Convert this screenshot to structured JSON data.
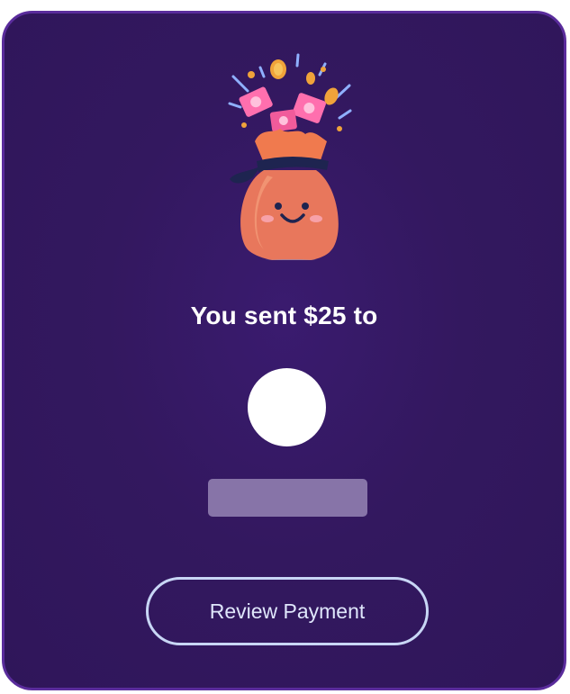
{
  "confirmation": {
    "headline": "You sent $25 to",
    "illustration_icon": "money-bag-icon",
    "avatar_icon": "avatar-placeholder",
    "review_button_label": "Review Payment"
  },
  "colors": {
    "card_background": "#33185f",
    "card_border": "#5a2c9c",
    "button_border": "#c8d6f5",
    "name_placeholder": "#8774a8"
  }
}
